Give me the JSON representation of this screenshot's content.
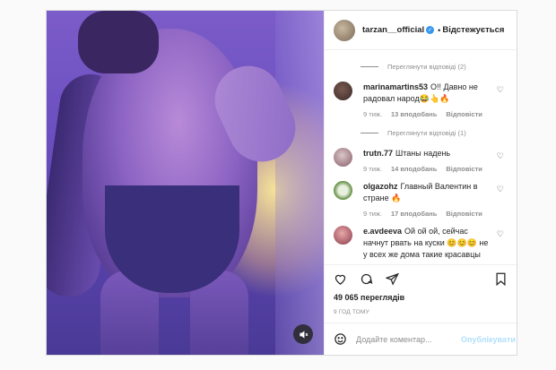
{
  "header": {
    "username": "tarzan__official",
    "separator": "•",
    "follow_label": "Відстежується"
  },
  "comments": {
    "view_replies_1": "Переглянути відповіді (2)",
    "view_replies_2": "Переглянути відповіді (1)",
    "items": [
      {
        "user": "marinamartins53",
        "text": "О!! Давно не радовал народ😂👆🔥",
        "time": "9 тиж.",
        "likes": "13 вподобань",
        "reply": "Відповісти"
      },
      {
        "user": "trutn.77",
        "text": "Штаны надень",
        "time": "9 тиж.",
        "likes": "14 вподобань",
        "reply": "Відповісти"
      },
      {
        "user": "olgazohz",
        "text": "Главный Валентин в стране 🔥",
        "time": "9 тиж.",
        "likes": "17 вподобань",
        "reply": "Відповісти"
      },
      {
        "user": "e.avdeeva",
        "text": "Ой ой ой, сейчас начнут рвать на куски 😊😊😊 не у всех же дома такие красавцы"
      }
    ]
  },
  "post": {
    "views": "49 065 переглядів",
    "time": "9 ГОД ТОМУ"
  },
  "add_comment": {
    "placeholder": "Додайте коментар...",
    "publish_label": "Опублікувати"
  },
  "icons": {
    "heart": "heart-icon",
    "comment": "comment-icon",
    "share": "share-icon",
    "save": "bookmark-icon",
    "emoji": "emoji-icon",
    "mute": "mute-icon"
  }
}
